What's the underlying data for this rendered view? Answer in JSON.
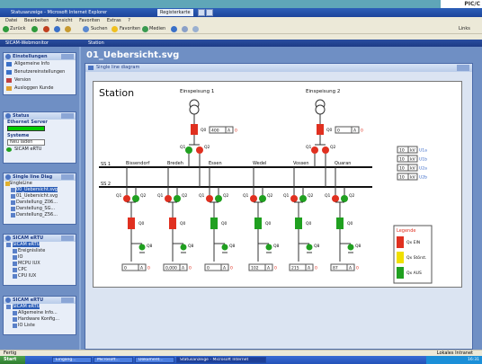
{
  "browser": {
    "title": "Statusanzeige - Microsoft Internet Explorer",
    "tab": "Registerkarte",
    "menu": [
      "Datei",
      "Bearbeiten",
      "Ansicht",
      "Favoriten",
      "Extras",
      "?"
    ],
    "toolbar": [
      "Zurück",
      "Suchen",
      "Favoriten",
      "Medien"
    ],
    "address_right": "Links",
    "brand": "PIC/C"
  },
  "app": {
    "header_left": "SICAM-Webmonitor",
    "header_right": "Station",
    "page_title": "01_Uebersicht.svg",
    "content_title": "Single line diagram"
  },
  "sidebar": {
    "settings": {
      "title": "Einstellungen",
      "items": [
        "Allgemeine Info",
        "Benutzereinstellungen",
        "Version",
        "Ausloggen Kunde"
      ]
    },
    "status": {
      "title": "Status",
      "server_label": "Ethernet Server",
      "server_value": "",
      "system_label": "Systeme",
      "system_value": "Neu laden",
      "device": "SICAM eRTU"
    },
    "singleline": {
      "title": "Single line Diag",
      "items": [
        "SingleLine",
        "00_Uebersicht.svg",
        "01_Uebersicht.svg",
        "Darstellung_Z06...",
        "Darstellung_SG...",
        "Darstellung_Z56..."
      ]
    },
    "sicam1": {
      "title": "SICAM eRTU",
      "items": [
        "SICAM eRTU",
        "Ereignisliste",
        "IO",
        "MCPU IUX",
        "CPC",
        "CPU IUX"
      ]
    },
    "sicam2": {
      "title": "SICAM eRTU",
      "items": [
        "SICAM eRTU",
        "Allgemeine Info...",
        "Hardware Konfig...",
        "IO Liste"
      ]
    }
  },
  "diagram": {
    "station": "Station",
    "feed1": {
      "label": "Einspeisung 1",
      "q0": "Q0",
      "q1": "Q1",
      "q2": "Q2",
      "value": "400",
      "unit": "A",
      "flag": "0"
    },
    "feed2": {
      "label": "Einspeisung 2",
      "q0": "Q0",
      "q1": "Q1",
      "q2": "Q2",
      "value": "0",
      "unit": "A",
      "flag": "0"
    },
    "busbars": [
      "SS 1",
      "SS 2"
    ],
    "voltages": [
      {
        "v": "10",
        "u": "kV",
        "n": "U1a"
      },
      {
        "v": "10",
        "u": "kV",
        "n": "U1b"
      },
      {
        "v": "10",
        "u": "kV",
        "n": "U2a"
      },
      {
        "v": "10",
        "u": "kV",
        "n": "U2b"
      }
    ],
    "feeders": [
      {
        "name": "Bissendorf",
        "value": "0",
        "q0_state": "red"
      },
      {
        "name": "Bredeh",
        "value": "0,000",
        "q0_state": "red"
      },
      {
        "name": "Essen",
        "value": "0",
        "q0_state": "green"
      },
      {
        "name": "Wedel",
        "value": "102",
        "q0_state": "green"
      },
      {
        "name": "Vossen",
        "value": "215",
        "q0_state": "green"
      },
      {
        "name": "Quaran",
        "value": "87",
        "q0_state": "green"
      }
    ],
    "feeder_unit": "A",
    "feeder_flag": "0",
    "switch_labels": {
      "q1": "Q1",
      "q2": "Q2",
      "q0": "Q0",
      "q8": "Q8"
    },
    "legend": {
      "title": "Legende",
      "items": [
        {
          "label": "Qx EIN",
          "color": "#e03020"
        },
        {
          "label": "Qx Störst.",
          "color": "#f0e000"
        },
        {
          "label": "Qx AUS",
          "color": "#20a020"
        }
      ]
    }
  },
  "status_bar": {
    "left": "Fertig",
    "right": "Lokales Intranet"
  },
  "taskbar": {
    "start": "Start",
    "tasks": [
      "Eingang...",
      "Microsoft...",
      "Dokument...",
      "Statusanzeige - Microsoft Internet"
    ],
    "clock": "16:31"
  }
}
